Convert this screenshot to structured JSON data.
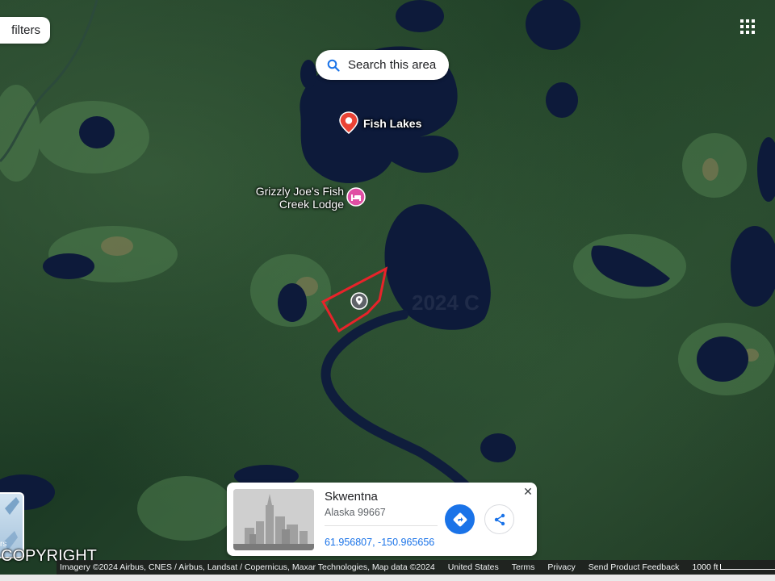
{
  "map": {
    "view": "satellite",
    "watermark": "2024 C"
  },
  "toolbar": {
    "filters_label": "filters",
    "search_area_label": "Search this area"
  },
  "places": {
    "fish_lakes": "Fish Lakes",
    "lodge_line1": "Grizzly Joe's Fish",
    "lodge_line2": "Creek Lodge"
  },
  "card": {
    "title": "Skwentna",
    "address": "Alaska 99667",
    "coordinates": "61.956807, -150.965656",
    "close_icon": "close-icon",
    "directions_icon": "directions-icon",
    "share_icon": "share-icon"
  },
  "layer_thumb_label": "rs",
  "copyright_overlay": "COPYRIGHT",
  "attribution": {
    "imagery": "Imagery ©2024 Airbus, CNES / Airbus, Landsat / Copernicus, Maxar Technologies, Map data ©2024",
    "country": "United States",
    "terms": "Terms",
    "privacy": "Privacy",
    "feedback": "Send Product Feedback",
    "scale": "1000 ft"
  },
  "colors": {
    "parcel_outline": "#e8232a",
    "pin_red": "#ea4335",
    "pin_pink": "#e04fa4",
    "accent_blue": "#1a73e8"
  }
}
